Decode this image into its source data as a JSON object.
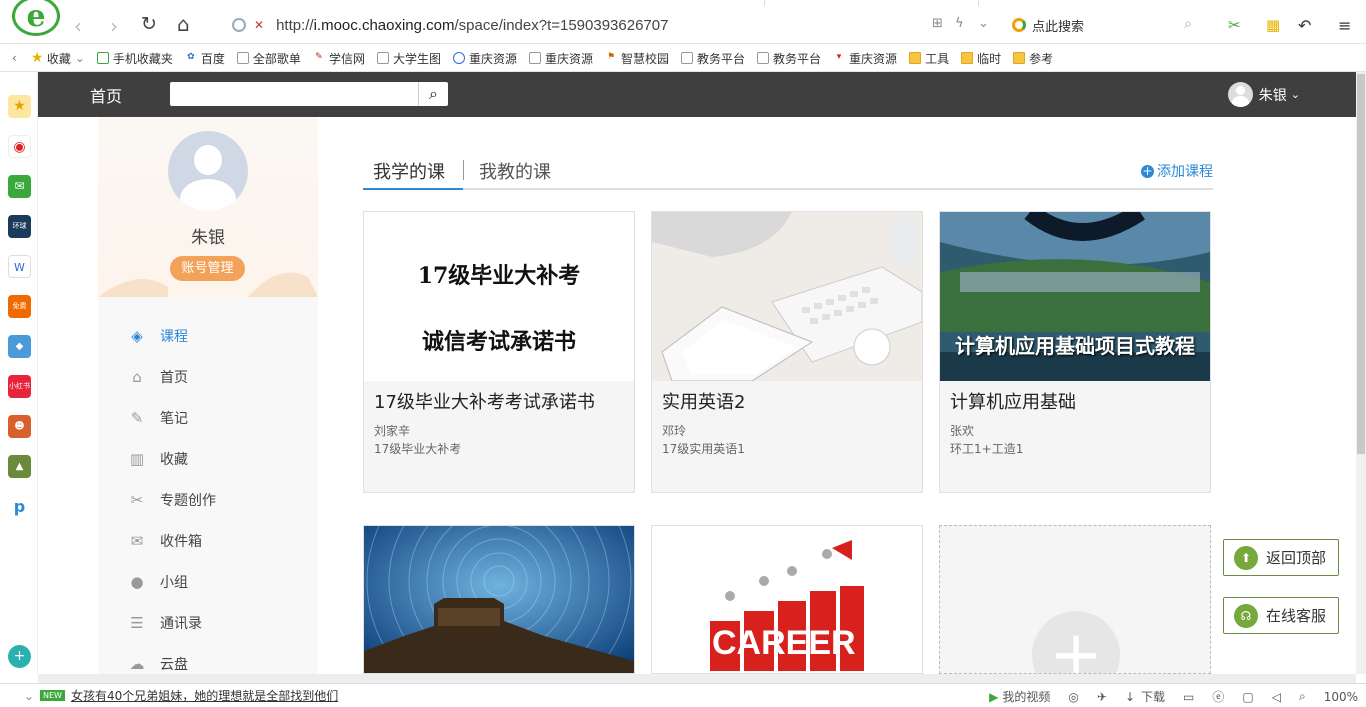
{
  "browser": {
    "url_prefix": "http://",
    "url_host": "i.mooc.chaoxing.com",
    "url_path": "/space/index?t=1590393626707",
    "search_placeholder": "点此搜索"
  },
  "bookmarks": [
    {
      "label": "收藏",
      "icon": "star-icon"
    },
    {
      "label": "手机收藏夹",
      "icon": "phone-icon"
    },
    {
      "label": "百度",
      "icon": "baidu-icon"
    },
    {
      "label": "全部歌单",
      "icon": "page-icon"
    },
    {
      "label": "学信网",
      "icon": "xuexin-icon"
    },
    {
      "label": "大学生图",
      "icon": "page-icon"
    },
    {
      "label": "重庆资源",
      "icon": "globe-icon"
    },
    {
      "label": "重庆资源",
      "icon": "page-icon"
    },
    {
      "label": "智慧校园",
      "icon": "campus-icon"
    },
    {
      "label": "教务平台",
      "icon": "page-icon"
    },
    {
      "label": "教务平台",
      "icon": "page-icon"
    },
    {
      "label": "重庆资源",
      "icon": "v-icon"
    },
    {
      "label": "工具",
      "icon": "folder-icon"
    },
    {
      "label": "临时",
      "icon": "folder-icon"
    },
    {
      "label": "参考",
      "icon": "folder-icon"
    }
  ],
  "topbar": {
    "home": "首页",
    "user_name": "朱银"
  },
  "profile": {
    "name": "朱银",
    "account_button": "账号管理"
  },
  "menu": [
    {
      "label": "课程",
      "icon": "course-icon",
      "active": true
    },
    {
      "label": "首页",
      "icon": "home-icon",
      "active": false
    },
    {
      "label": "笔记",
      "icon": "note-icon",
      "active": false
    },
    {
      "label": "收藏",
      "icon": "book-icon",
      "active": false
    },
    {
      "label": "专题创作",
      "icon": "topic-icon",
      "active": false
    },
    {
      "label": "收件箱",
      "icon": "inbox-icon",
      "active": false
    },
    {
      "label": "小组",
      "icon": "group-icon",
      "active": false
    },
    {
      "label": "通讯录",
      "icon": "contacts-icon",
      "active": false
    },
    {
      "label": "云盘",
      "icon": "cloud-icon",
      "active": false
    }
  ],
  "tabs": {
    "learning": "我学的课",
    "teaching": "我教的课",
    "add_course": "添加课程"
  },
  "courses": [
    {
      "title": "17级毕业大补考考试承诺书",
      "teacher": "刘家辛",
      "class": "17级毕业大补考",
      "thumb_line1": "17级毕业大补考",
      "thumb_line2": "诚信考试承诺书"
    },
    {
      "title": "实用英语2",
      "teacher": "邓玲",
      "class": "17级实用英语1"
    },
    {
      "title": "计算机应用基础",
      "teacher": "张欢",
      "class": "环工1+工造1",
      "thumb_text": "计算机应用基础项目式教程"
    }
  ],
  "float_buttons": {
    "back_to_top": "返回顶部",
    "online_service": "在线客服"
  },
  "status": {
    "news": "女孩有40个兄弟姐妹，她的理想就是全部找到他们",
    "my_video": "我的视频",
    "download": "下载",
    "zoom": "100%"
  },
  "colors": {
    "accent_blue": "#2a8ad8",
    "topbar": "#3f3f3f",
    "account_button": "#f3a25a",
    "float_green": "#76a83c"
  }
}
